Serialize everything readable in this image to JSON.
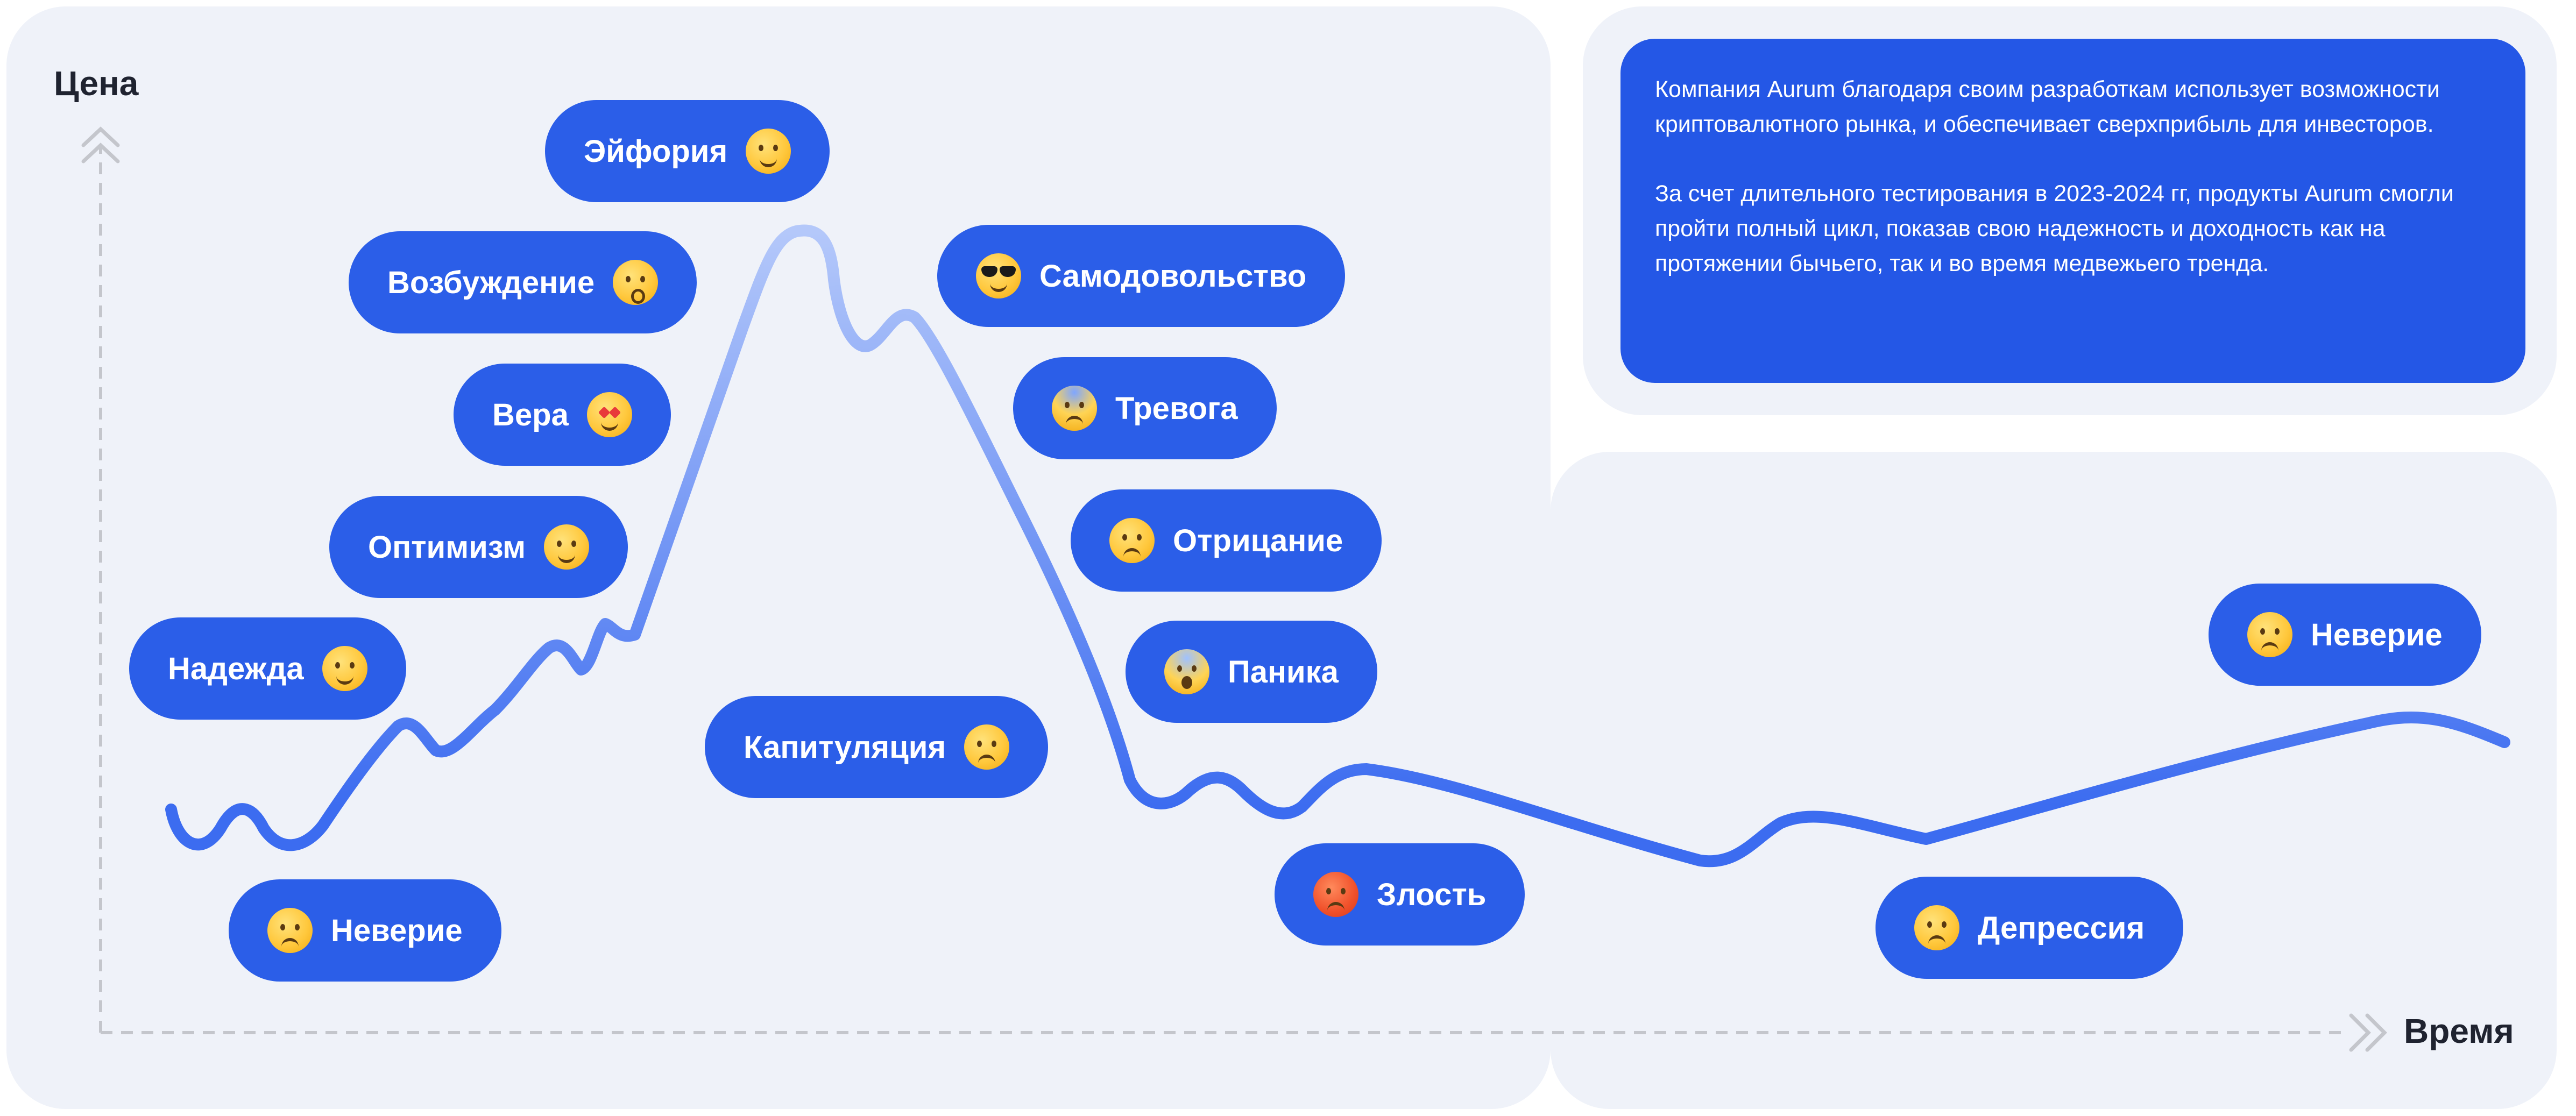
{
  "axes": {
    "y_label": "Цена",
    "x_label": "Время"
  },
  "info": {
    "paragraph_1": "Компания Aurum благодаря своим разработкам использует возможности криптовалютного рынка, и обеспечивает сверхприбыль для инвесторов.",
    "paragraph_2": "За счет длительного тестирования в 2023-2024 гг, продукты Aurum смогли пройти полный цикл, показав свою надежность и доходность как на протяжении бычьего, так и во время медвежьего тренда."
  },
  "stages": [
    {
      "label": "Неверие",
      "icon": "disappointed-face-icon"
    },
    {
      "label": "Надежда",
      "icon": "relieved-face-icon"
    },
    {
      "label": "Оптимизм",
      "icon": "grinning-face-icon"
    },
    {
      "label": "Вера",
      "icon": "star-struck-face-icon"
    },
    {
      "label": "Возбуждение",
      "icon": "hushed-face-icon"
    },
    {
      "label": "Эйфория",
      "icon": "partying-face-icon"
    },
    {
      "label": "Самодовольство",
      "icon": "sunglasses-face-icon"
    },
    {
      "label": "Тревога",
      "icon": "anxious-face-icon"
    },
    {
      "label": "Отрицание",
      "icon": "confounded-face-icon"
    },
    {
      "label": "Паника",
      "icon": "screaming-face-icon"
    },
    {
      "label": "Капитуляция",
      "icon": "weary-face-icon"
    },
    {
      "label": "Злость",
      "icon": "angry-face-icon"
    },
    {
      "label": "Депрессия",
      "icon": "pensive-face-icon"
    },
    {
      "label": "Неверие",
      "icon": "disappointed-face-icon"
    }
  ],
  "colors": {
    "pill": "#2b5ee8",
    "info_box": "#2457e6",
    "curve_light": "#b4c8fa",
    "curve_dark": "#3c6cf0",
    "axis": "#c4c6cc"
  }
}
